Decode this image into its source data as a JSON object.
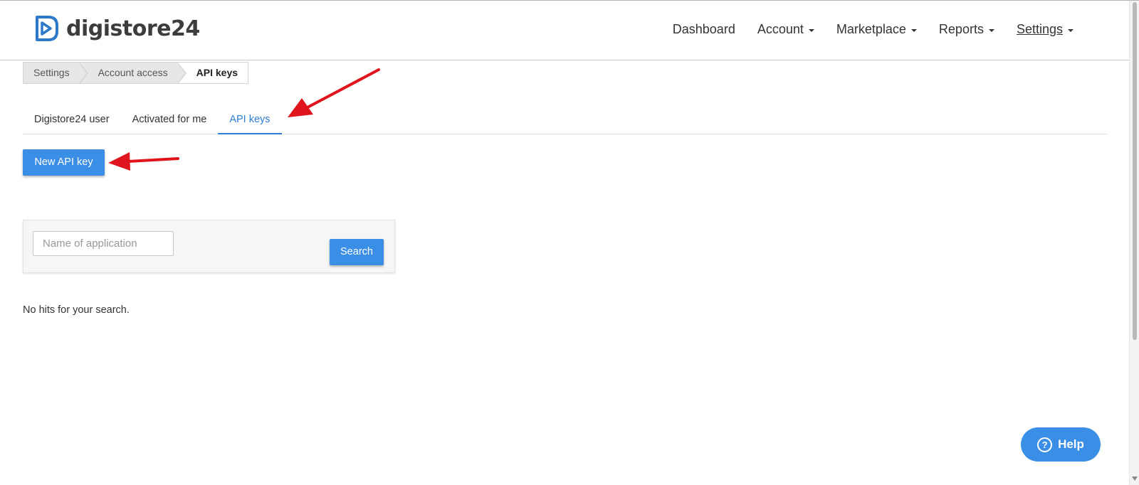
{
  "header": {
    "logo_text": "digistore24",
    "nav": [
      {
        "label": "Dashboard",
        "has_caret": false,
        "active": false
      },
      {
        "label": "Account",
        "has_caret": true,
        "active": false
      },
      {
        "label": "Marketplace",
        "has_caret": true,
        "active": false
      },
      {
        "label": "Reports",
        "has_caret": true,
        "active": false
      },
      {
        "label": "Settings",
        "has_caret": true,
        "active": true
      }
    ]
  },
  "breadcrumb": [
    "Settings",
    "Account access",
    "API keys"
  ],
  "tabs": [
    {
      "label": "Digistore24 user",
      "active": false
    },
    {
      "label": "Activated for me",
      "active": false
    },
    {
      "label": "API keys",
      "active": true
    }
  ],
  "actions": {
    "new_api_key_label": "New API key"
  },
  "search": {
    "placeholder": "Name of application",
    "value": "",
    "button_label": "Search"
  },
  "results": {
    "empty_message": "No hits for your search."
  },
  "help": {
    "label": "Help",
    "icon_glyph": "?"
  },
  "colors": {
    "accent": "#3a8ee6",
    "annotation_arrow": "#e0141c",
    "active_tab": "#2f7ed8"
  },
  "annotations": [
    {
      "name": "arrow-to-api-keys-tab",
      "icon": "red-arrow"
    },
    {
      "name": "arrow-to-new-api-key-button",
      "icon": "red-arrow"
    }
  ]
}
